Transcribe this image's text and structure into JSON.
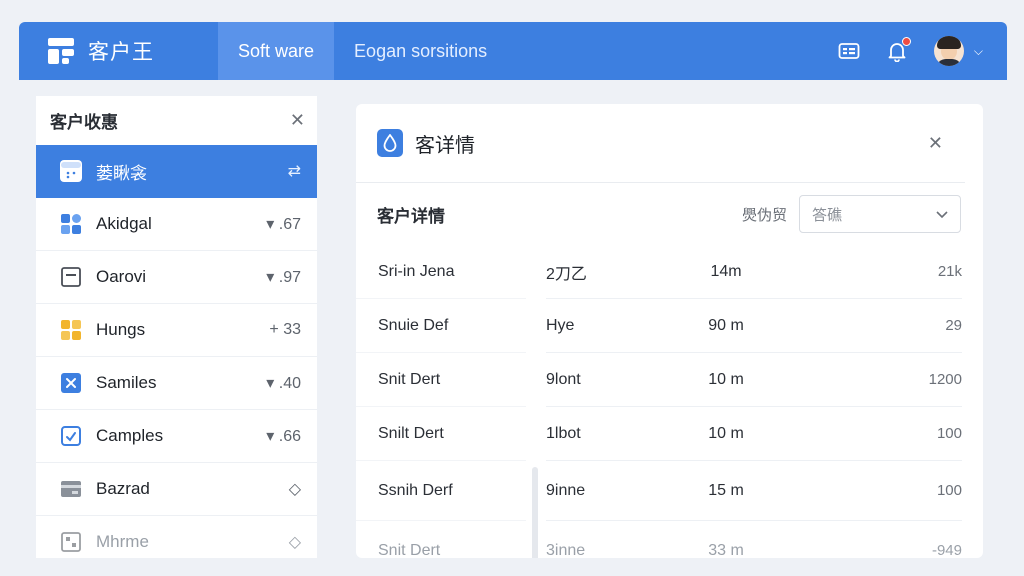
{
  "header": {
    "app_title": "客户王",
    "tabs": [
      {
        "label": "Soft ware",
        "active": true
      },
      {
        "label": "Eogan sorsitions",
        "active": false
      }
    ],
    "accent": "#3d7fe0",
    "notification_dot_color": "#ef4d44"
  },
  "sidebar": {
    "title": "客户收惠",
    "items": [
      {
        "label": "蒌瞅衾",
        "value": "",
        "icon": "calendar-icon",
        "active": true
      },
      {
        "label": "Akidgal",
        "value": "▾ .67",
        "icon": "grid-apps-icon"
      },
      {
        "label": "Oarovi",
        "value": "▾ .97",
        "icon": "square-minus-icon"
      },
      {
        "label": "Hungs",
        "value": "+ 33",
        "icon": "grid-yellow-icon"
      },
      {
        "label": "Samiles",
        "value": "▾ .40",
        "icon": "cross-square-icon"
      },
      {
        "label": "Camples",
        "value": "▾ .66",
        "icon": "check-square-icon"
      },
      {
        "label": "Bazrad",
        "value": "◇",
        "icon": "card-icon"
      },
      {
        "label": "Mhrme",
        "value": "◇",
        "icon": "grid-square-icon",
        "faded": true
      }
    ]
  },
  "detail": {
    "title": "客详情",
    "subtitle": "客户详情",
    "meta_label": "爂伪贸",
    "select_value": "答礁",
    "rows": [
      {
        "name": "Sri-in Jena",
        "c2": "2刀乙",
        "c3": "14m",
        "c4": "21k"
      },
      {
        "name": "Snuie Def",
        "c2": "Hye",
        "c3": "90 m",
        "c4": "29"
      },
      {
        "name": "Snit Dert",
        "c2": "9lont",
        "c3": "10 m",
        "c4": "1200"
      },
      {
        "name": "Snilt Dert",
        "c2": "1lbot",
        "c3": "10 m",
        "c4": "100"
      },
      {
        "name": "Ssnih Derf",
        "c2": "9inne",
        "c3": "15 m",
        "c4": "100"
      },
      {
        "name": "Snit Dert",
        "c2": "3inne",
        "c3": "33 m",
        "c4": "-949",
        "faded": true
      }
    ]
  }
}
